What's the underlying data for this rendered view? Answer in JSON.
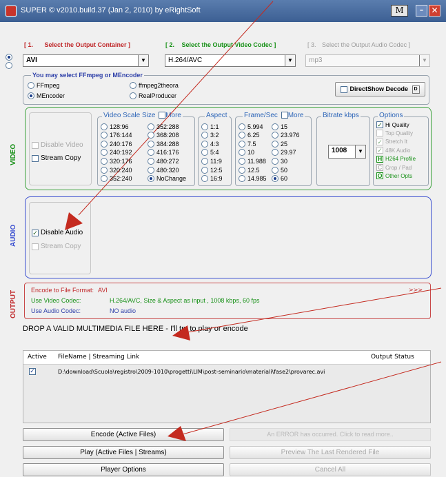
{
  "window": {
    "title": "SUPER © v2010.build.37 (Jan 2, 2010) by eRightSoft",
    "m_button": "M",
    "minimize_glyph": "–",
    "close_glyph": "✕"
  },
  "sections": {
    "container": {
      "num": "[ 1.",
      "label": "Select the Output Container ]",
      "value": "AVI"
    },
    "video_codec": {
      "num": "[ 2.",
      "label": "Select the Output Video Codec ]",
      "value": "H.264/AVC"
    },
    "audio_codec": {
      "num": "[ 3.",
      "label": "Select the Output Audio Codec ]",
      "value": "mp3"
    }
  },
  "encoder": {
    "label": "You may select FFmpeg or MEncoder",
    "options": [
      "FFmpeg",
      "ffmpeg2theora",
      "MEncoder",
      "RealProducer"
    ],
    "selected": "MEncoder"
  },
  "directshow": {
    "label": "DirectShow Decode"
  },
  "video": {
    "side_label": "VIDEO",
    "disable_label": "Disable Video",
    "stream_copy_label": "Stream Copy",
    "scale": {
      "title": "Video Scale Size",
      "more": "More",
      "left": [
        "128:96",
        "176:144",
        "240:176",
        "240:192",
        "320:176",
        "320:240",
        "352:240"
      ],
      "right": [
        "352:288",
        "368:208",
        "384:288",
        "416:176",
        "480:272",
        "480:320",
        "NoChange"
      ],
      "selected": "NoChange"
    },
    "aspect": {
      "title": "Aspect",
      "values": [
        "1:1",
        "3:2",
        "4:3",
        "5:4",
        "11:9",
        "12:5",
        "16:9"
      ]
    },
    "fps": {
      "title": "Frame/Sec",
      "more": "More",
      "left": [
        "5.994",
        "6.25",
        "7.5",
        "10",
        "11.988",
        "12.5",
        "14.985"
      ],
      "right": [
        "15",
        "23.976",
        "25",
        "29.97",
        "30",
        "50",
        "60"
      ],
      "selected": "60"
    },
    "bitrate": {
      "title": "Bitrate  kbps",
      "value": "1008"
    },
    "options": {
      "title": "Options",
      "items": [
        {
          "label": "Hi Quality",
          "checked": true,
          "enabled": true
        },
        {
          "label": "Top Quality",
          "checked": false,
          "enabled": false
        },
        {
          "label": "Stretch It",
          "checked": true,
          "enabled": false
        },
        {
          "label": "48K Audio",
          "checked": true,
          "enabled": false
        },
        {
          "label": "H264 Profile",
          "box": "H",
          "enabled": true
        },
        {
          "label": "Crop / Pad",
          "box": "C",
          "enabled": false
        },
        {
          "label": "Other Opts",
          "box": "O",
          "enabled": true
        }
      ]
    }
  },
  "audio": {
    "side_label": "AUDIO",
    "disable_label": "Disable Audio",
    "stream_copy_label": "Stream Copy"
  },
  "output": {
    "side_label": "OUTPUT",
    "lines": [
      {
        "label": "Encode to File Format:",
        "value": "AVI"
      },
      {
        "label": "Use Video Codec:",
        "value": "H.264/AVC,  Size & Aspect as input ,  1008 kbps,  60 fps"
      },
      {
        "label": "Use Audio Codec:",
        "value": "NO audio"
      }
    ],
    "more": ">>>"
  },
  "drop_text": "DROP A VALID MULTIMEDIA FILE HERE - I'll try to play or encode",
  "file_table": {
    "headers": [
      "Active",
      "FileName  |  Streaming Link",
      "Output Status"
    ],
    "rows": [
      {
        "active": true,
        "file": "D:\\download\\Scuola\\registro\\2009-1010\\progetti\\LIM\\post-seminario\\materiali\\fase2\\provarec.avi",
        "status": ""
      }
    ]
  },
  "buttons": {
    "encode": "Encode (Active Files)",
    "error": "An ERROR has occurred. Click to read more..",
    "play": "Play (Active Files | Streams)",
    "preview": "Preview The Last Rendered File",
    "player_options": "Player Options",
    "cancel": "Cancel All"
  }
}
